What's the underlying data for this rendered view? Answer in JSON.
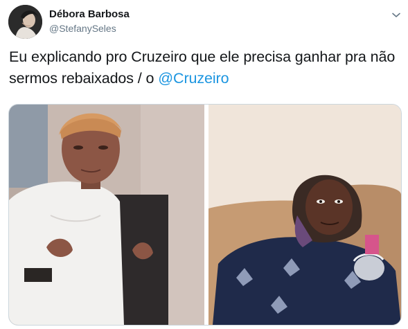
{
  "tweet": {
    "author_name": "Débora Barbosa",
    "author_handle": "@StefanySeles",
    "text_prefix": "Eu explicando pro Cruzeiro que ele precisa ganhar pra não sermos rebaixados / o ",
    "mention": "@Cruzeiro",
    "icons": {
      "menu": "chevron-down-icon"
    },
    "colors": {
      "name": "#14171a",
      "handle": "#657786",
      "mention": "#1b95e0",
      "media_border": "#ccd6dd"
    }
  }
}
